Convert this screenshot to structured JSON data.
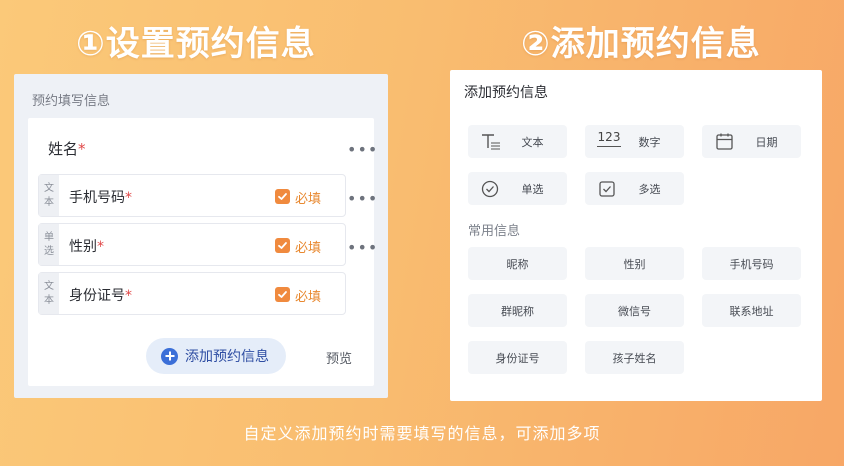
{
  "step1_title": "①设置预约信息",
  "step2_title": "②添加预约信息",
  "left_panel": {
    "header": "预约填写信息",
    "name_label": "姓名",
    "required_mark": "*",
    "fields": [
      {
        "type_top": "文",
        "type_bottom": "本",
        "label": "手机号码",
        "required_label": "必填"
      },
      {
        "type_top": "单",
        "type_bottom": "选",
        "label": "性别",
        "required_label": "必填"
      },
      {
        "type_top": "文",
        "type_bottom": "本",
        "label": "身份证号",
        "required_label": "必填"
      }
    ],
    "more_label": "•••",
    "add_button_label": "添加预约信息",
    "preview_label": "预览",
    "checkbox_color": "#f08a3e",
    "add_button_color": "#3b6fd8"
  },
  "right_panel": {
    "header": "添加预约信息",
    "types": [
      {
        "icon": "text-format-icon",
        "label": "文本"
      },
      {
        "icon": "number-icon",
        "label": "数字",
        "icon_text": "123"
      },
      {
        "icon": "calendar-icon",
        "label": "日期"
      },
      {
        "icon": "radio-circle-check-icon",
        "label": "单选"
      },
      {
        "icon": "checkbox-check-icon",
        "label": "多选"
      }
    ],
    "common_section_label": "常用信息",
    "common_items": [
      "昵称",
      "性别",
      "手机号码",
      "群昵称",
      "微信号",
      "联系地址",
      "身份证号",
      "孩子姓名"
    ]
  },
  "footer_note": "自定义添加预约时需要填写的信息，可添加多项"
}
